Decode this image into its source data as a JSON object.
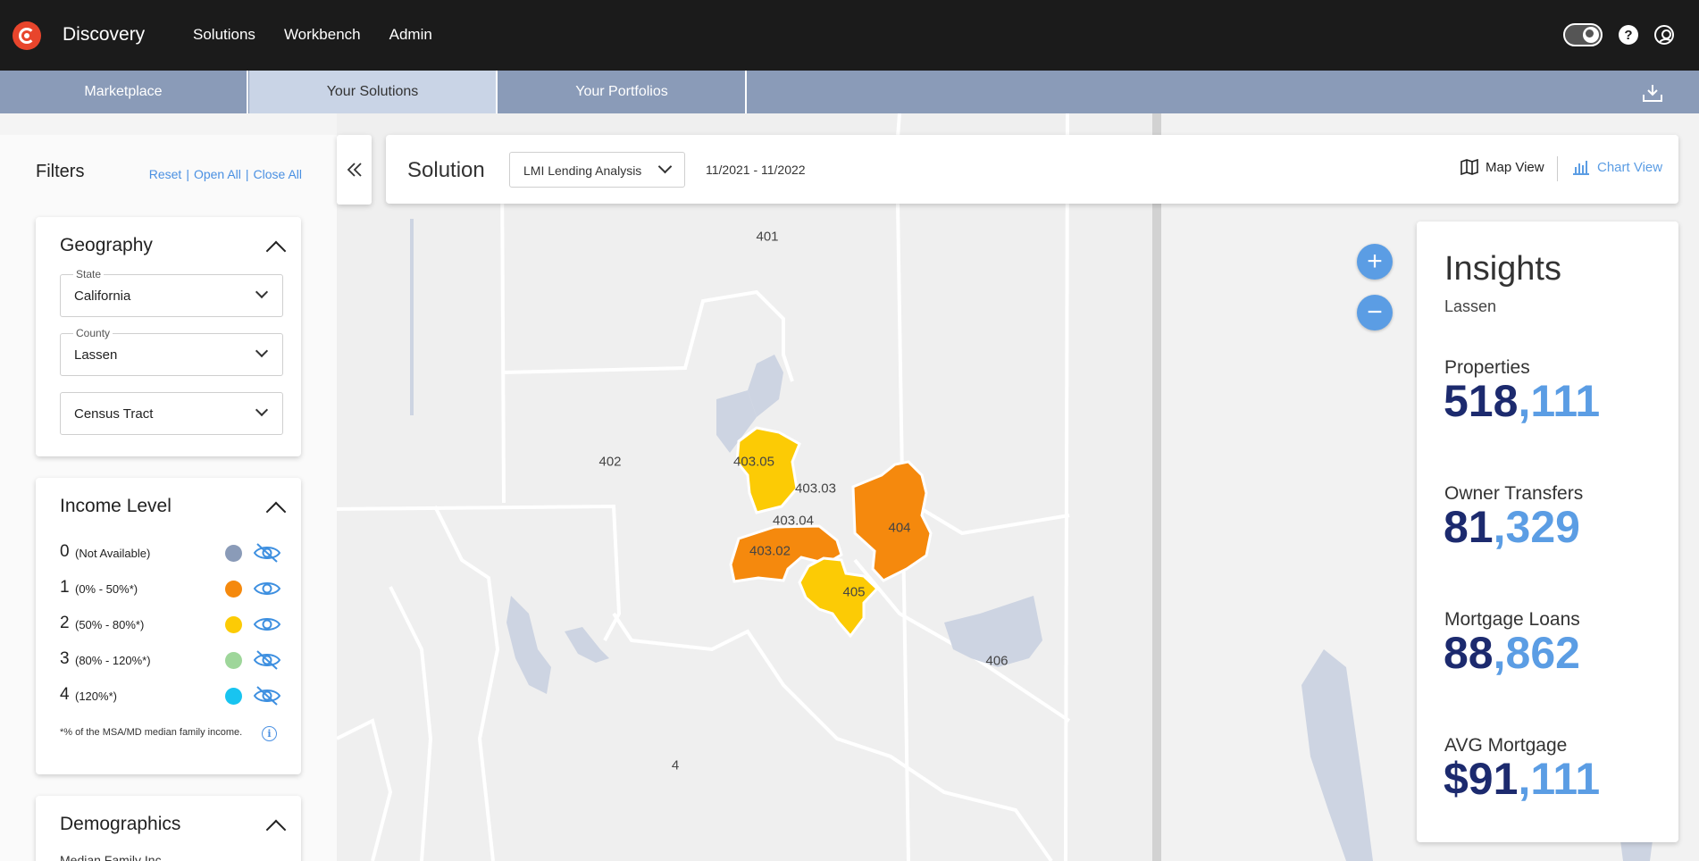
{
  "app": {
    "brand": "Discovery"
  },
  "topnav": [
    "Solutions",
    "Workbench",
    "Admin"
  ],
  "tabs": [
    {
      "label": "Marketplace",
      "active": false
    },
    {
      "label": "Your Solutions",
      "active": true
    },
    {
      "label": "Your Portfolios",
      "active": false
    }
  ],
  "filters": {
    "title": "Filters",
    "reset": "Reset",
    "open_all": "Open All",
    "close_all": "Close All",
    "sep": "|",
    "geography": {
      "title": "Geography",
      "state_label": "State",
      "state_value": "California",
      "county_label": "County",
      "county_value": "Lassen",
      "tract_value": "Census Tract"
    },
    "income": {
      "title": "Income Level",
      "levels": [
        {
          "level": "0",
          "range": "(Not Available)",
          "color": "#8a9bb8",
          "visible": false
        },
        {
          "level": "1",
          "range": "(0% - 50%*)",
          "color": "#f5890d",
          "visible": true
        },
        {
          "level": "2",
          "range": "(50% - 80%*)",
          "color": "#fccb05",
          "visible": true
        },
        {
          "level": "3",
          "range": "(80% - 120%*)",
          "color": "#9ed69a",
          "visible": false
        },
        {
          "level": "4",
          "range": "(120%*)",
          "color": "#18c4f0",
          "visible": false
        }
      ],
      "footnote": "*% of the MSA/MD median family income.",
      "info": "i"
    },
    "demographics": {
      "title": "Demographics",
      "partial": "Median Family Inc..."
    }
  },
  "solution": {
    "label": "Solution",
    "selected": "LMI Lending Analysis",
    "date_range": "11/2021 - 11/2022",
    "map_view": "Map View",
    "chart_view": "Chart View"
  },
  "zoom": {
    "in": "+",
    "out": "−"
  },
  "map": {
    "tracts": [
      "401",
      "402",
      "403.05",
      "403.03",
      "403.04",
      "403.02",
      "404",
      "405",
      "406",
      "4"
    ]
  },
  "insights": {
    "title": "Insights",
    "location": "Lassen",
    "metrics": [
      {
        "label": "Properties",
        "value_a": "518",
        "value_b": ",111"
      },
      {
        "label": "Owner Transfers",
        "value_a": "81",
        "value_b": ",329"
      },
      {
        "label": "Mortgage Loans",
        "value_a": "88",
        "value_b": ",862"
      },
      {
        "label": "AVG Mortgage",
        "value_a": "$91",
        "value_b": ",111"
      }
    ]
  },
  "colors": {
    "accent": "#4a90e2",
    "low_income": "#f5890d",
    "moderate_income": "#fccb05",
    "water": "#cdd4e2"
  }
}
